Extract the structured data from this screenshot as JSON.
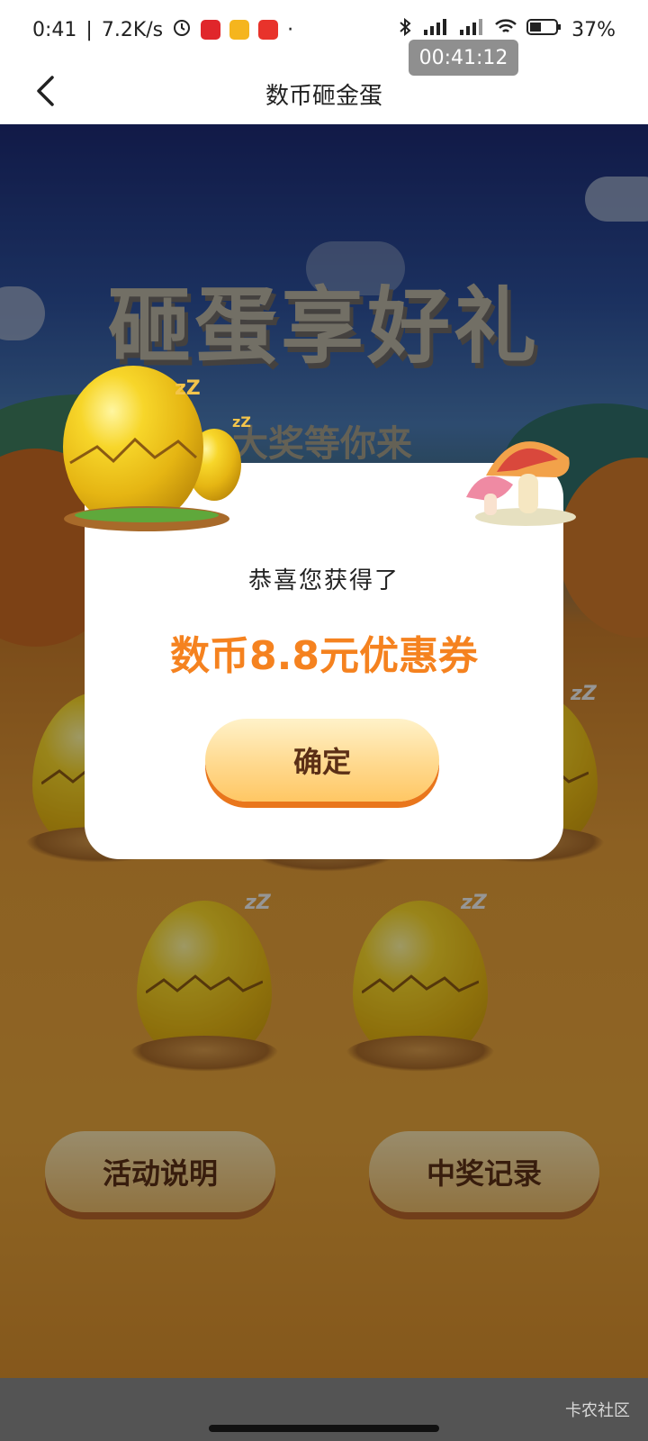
{
  "status_bar": {
    "time": "0:41",
    "speed": "7.2K/s",
    "timer": "00:41:12",
    "battery": "37%"
  },
  "nav": {
    "back_icon": "chevron-left-icon",
    "title": "数币砸金蛋"
  },
  "background": {
    "title_art": "砸蛋享好礼",
    "subtitle_art": "大奖等你来"
  },
  "eggs": [
    {
      "zz": "zZ"
    },
    {
      "zz": "zZ"
    },
    {
      "zz": "zZ"
    },
    {
      "zz": "zZ"
    },
    {
      "zz": "zZ"
    },
    {
      "zz": "zZ"
    }
  ],
  "buttons": {
    "rules": "活动说明",
    "records": "中奖记录"
  },
  "dialog": {
    "heading": "恭喜您获得了",
    "prize": "数币8.8元优惠券",
    "confirm": "确定"
  },
  "footer": {
    "watermark": "卡农社区"
  },
  "colors": {
    "prize": "#f5821f",
    "confirm_shadow": "#e9761c",
    "button_text": "#5b2f16"
  }
}
